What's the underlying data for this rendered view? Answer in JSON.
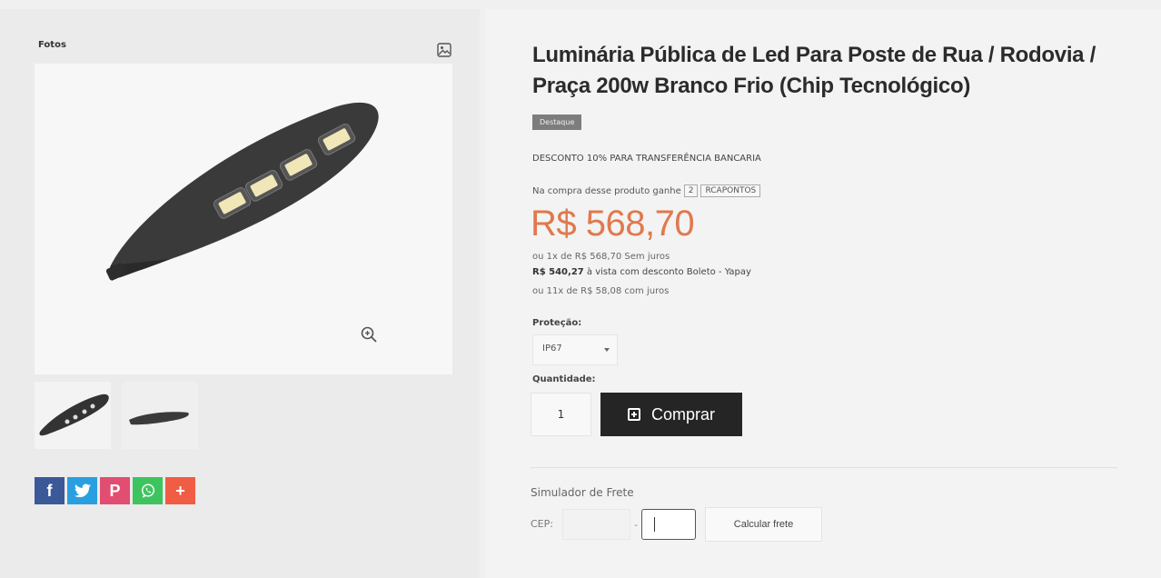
{
  "gallery": {
    "photos_label": "Fotos"
  },
  "social": {
    "facebook": "f",
    "pinterest": "P",
    "plus": "+"
  },
  "product": {
    "title": "Luminária Pública de Led Para Poste de Rua / Rodovia / Praça 200w Branco Frio (Chip Tecnológico)",
    "badge": "Destaque",
    "discount_message": "DESCONTO 10% PARA TRANSFERÊNCIA BANCARIA",
    "points": {
      "prefix": "Na compra desse produto ganhe",
      "value": "2",
      "unit": "RCAPONTOS"
    },
    "price": "R$ 568,70",
    "installment_1": "ou 1x de R$ 568,70 Sem juros",
    "boleto_price": "R$ 540,27",
    "boleto_text": "à vista com desconto Boleto - Yapay",
    "installment_11": "ou 11x de R$ 58,08 com juros"
  },
  "options": {
    "protection_label": "Proteção:",
    "protection_value": "IP67",
    "quantity_label": "Quantidade:",
    "quantity_value": "1",
    "buy_label": "Comprar"
  },
  "shipping": {
    "title": "Simulador de Frete",
    "cep_label": "CEP:",
    "dash": "-",
    "calc_button": "Calcular frete"
  },
  "colors": {
    "price": "#e0794d",
    "buy_button": "#252525",
    "facebook": "#3b5998",
    "twitter": "#2a9fe0",
    "pinterest": "#e14e72",
    "whatsapp": "#3ec45f",
    "plus": "#f05d44"
  }
}
